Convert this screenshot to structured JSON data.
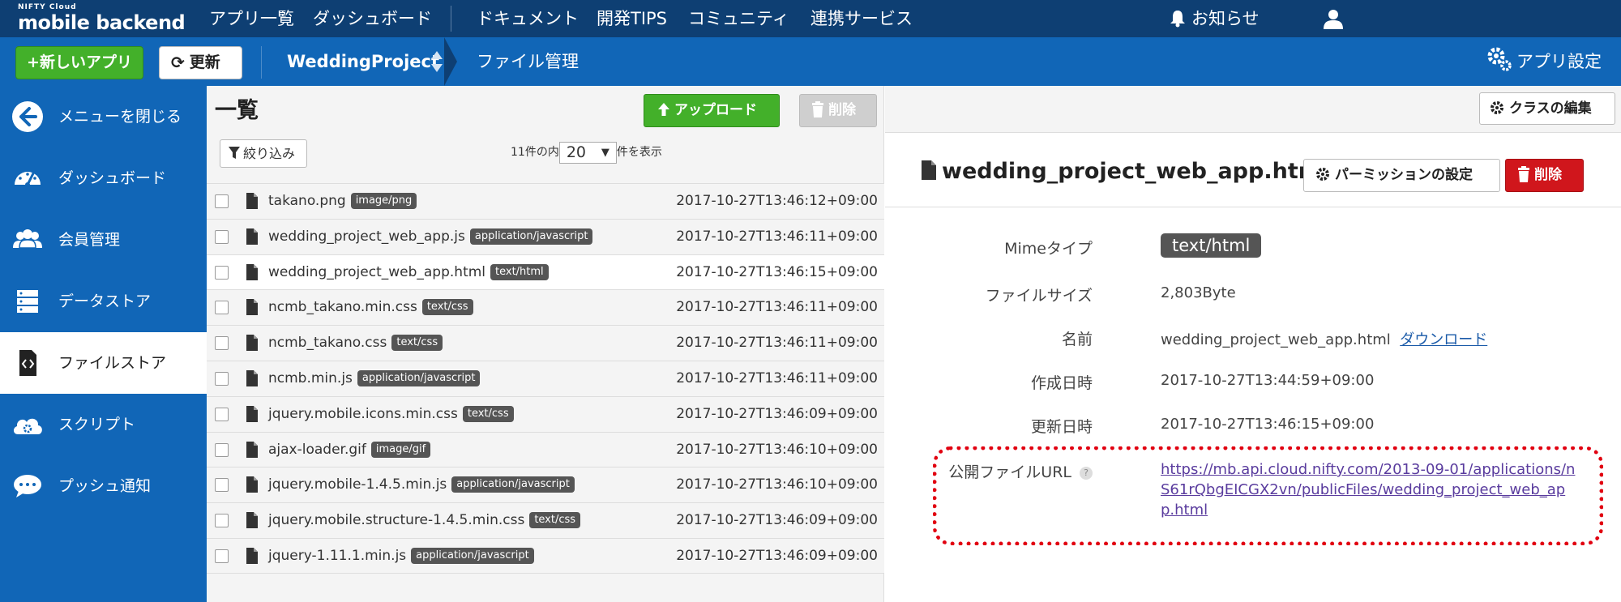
{
  "topnav": {
    "logo_small": "NIFTY Cloud",
    "logo_main": "mobile backend",
    "items": [
      "アプリ一覧",
      "ダッシュボード",
      "ドキュメント",
      "開発TIPS",
      "コミュニティ",
      "連携サービス"
    ],
    "notice": "お知らせ"
  },
  "appbar": {
    "new_app": "+新しいアプリ",
    "refresh": "更新",
    "project": "WeddingProject",
    "breadcrumb": "ファイル管理",
    "app_settings": "アプリ設定"
  },
  "sidebar": {
    "items": [
      {
        "label": "メニューを閉じる",
        "icon": "arrow-left-icon"
      },
      {
        "label": "ダッシュボード",
        "icon": "gauge-icon"
      },
      {
        "label": "会員管理",
        "icon": "users-icon"
      },
      {
        "label": "データストア",
        "icon": "database-icon"
      },
      {
        "label": "ファイルストア",
        "icon": "file-code-icon"
      },
      {
        "label": "スクリプト",
        "icon": "cloud-gear-icon"
      },
      {
        "label": "プッシュ通知",
        "icon": "speech-bubble-icon"
      }
    ],
    "active_index": 4
  },
  "list": {
    "title": "一覧",
    "upload": "アップロード",
    "delete": "削除",
    "filter": "絞り込み",
    "count_prefix": "11件の内",
    "page_size": "20",
    "count_suffix": "件を表示",
    "files": [
      {
        "name": "takano.png",
        "type": "image/png",
        "date": "2017-10-27T13:46:12+09:00"
      },
      {
        "name": "wedding_project_web_app.js",
        "type": "application/javascript",
        "date": "2017-10-27T13:46:11+09:00"
      },
      {
        "name": "wedding_project_web_app.html",
        "type": "text/html",
        "date": "2017-10-27T13:46:15+09:00"
      },
      {
        "name": "ncmb_takano.min.css",
        "type": "text/css",
        "date": "2017-10-27T13:46:11+09:00"
      },
      {
        "name": "ncmb_takano.css",
        "type": "text/css",
        "date": "2017-10-27T13:46:11+09:00"
      },
      {
        "name": "ncmb.min.js",
        "type": "application/javascript",
        "date": "2017-10-27T13:46:11+09:00"
      },
      {
        "name": "jquery.mobile.icons.min.css",
        "type": "text/css",
        "date": "2017-10-27T13:46:09+09:00"
      },
      {
        "name": "ajax-loader.gif",
        "type": "image/gif",
        "date": "2017-10-27T13:46:10+09:00"
      },
      {
        "name": "jquery.mobile-1.4.5.min.js",
        "type": "application/javascript",
        "date": "2017-10-27T13:46:10+09:00"
      },
      {
        "name": "jquery.mobile.structure-1.4.5.min.css",
        "type": "text/css",
        "date": "2017-10-27T13:46:09+09:00"
      },
      {
        "name": "jquery-1.11.1.min.js",
        "type": "application/javascript",
        "date": "2017-10-27T13:46:09+09:00"
      }
    ],
    "selected_index": 2
  },
  "detail": {
    "class_edit": "クラスの編集",
    "title": "wedding_project_web_app.html",
    "permission": "パーミッションの設定",
    "delete": "削除",
    "props": {
      "mime_label": "Mimeタイプ",
      "mime_value": "text/html",
      "size_label": "ファイルサイズ",
      "size_value": "2,803Byte",
      "name_label": "名前",
      "name_value": "wedding_project_web_app.html",
      "download": "ダウンロード",
      "created_label": "作成日時",
      "created_value": "2017-10-27T13:44:59+09:00",
      "updated_label": "更新日時",
      "updated_value": "2017-10-27T13:46:15+09:00",
      "url_label": "公開ファイルURL",
      "url_help": "?",
      "url_value": "https://mb.api.cloud.nifty.com/2013-09-01/applications/nS61rQbgEICGX2vn/publicFiles/wedding_project_web_app.html"
    }
  },
  "colors": {
    "topnav": "#0e3f73",
    "appbar": "#1166b7",
    "green": "#43b02a",
    "red": "#d0161c",
    "highlight": "#e10010"
  }
}
